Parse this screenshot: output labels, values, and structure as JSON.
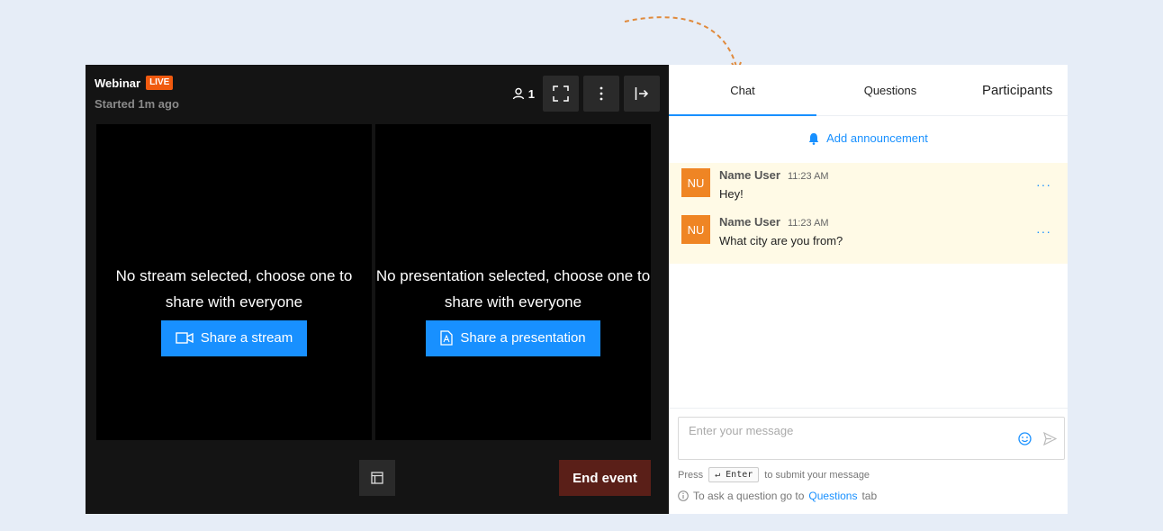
{
  "player": {
    "title": "Webinar",
    "live_badge": "LIVE",
    "started": "Started 1m ago",
    "participant_count": "1",
    "left_stage": {
      "message": "No stream selected, choose one to share with everyone",
      "button": "Share a stream"
    },
    "right_stage": {
      "message": "No presentation selected, choose one to share with everyone",
      "button": "Share a presentation"
    },
    "end_button": "End event"
  },
  "sidebar": {
    "tabs": [
      {
        "label": "Chat"
      },
      {
        "label": "Questions"
      },
      {
        "label": "Participants"
      }
    ],
    "announce": "Add announcement",
    "messages": [
      {
        "initials": "NU",
        "user": "Name User",
        "time": "11:23 AM",
        "text": "Hey!"
      },
      {
        "initials": "NU",
        "user": "Name User",
        "time": "11:23 AM",
        "text": "What city are you from?"
      }
    ],
    "input_placeholder": "Enter your message",
    "hint_press": "Press",
    "hint_key": "↵ Enter",
    "hint_tail": "to submit your message",
    "info_prefix": "To ask a question go to",
    "info_link": "Questions",
    "info_suffix": "tab"
  },
  "colors": {
    "accent": "#1890ff",
    "live": "#f05a0f",
    "avatar": "#ef8524",
    "end_button": "#5a1f18",
    "message_highlight": "#fffae6"
  }
}
